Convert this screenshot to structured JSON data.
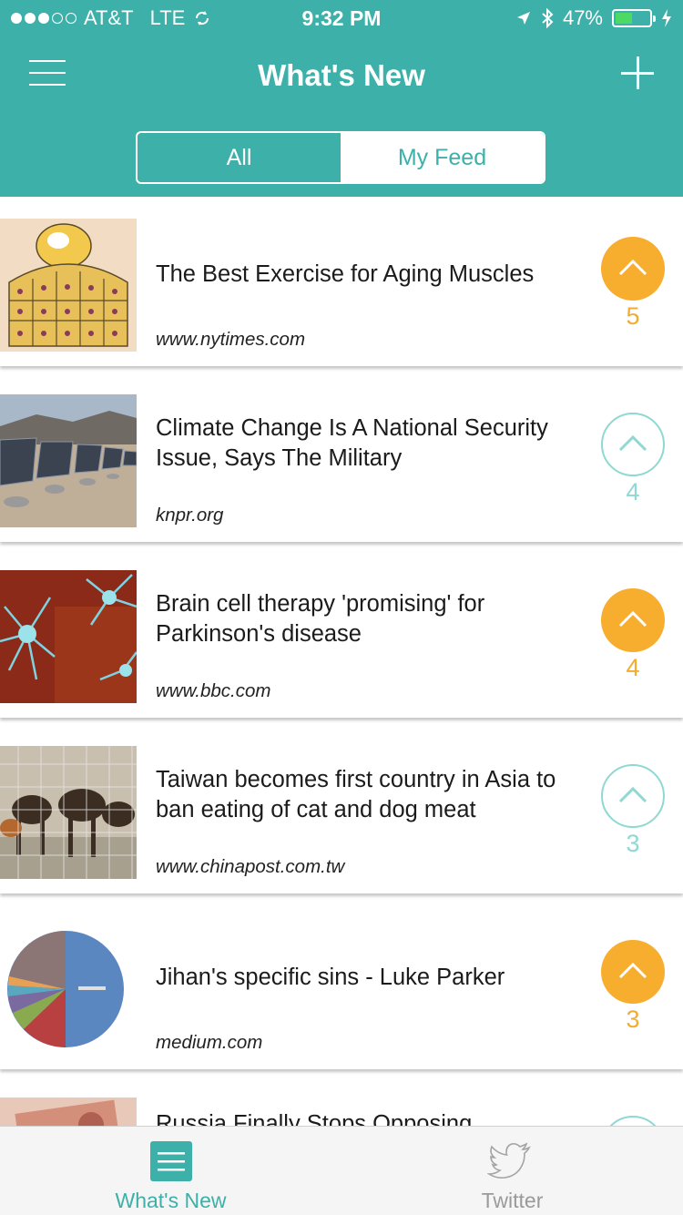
{
  "status_bar": {
    "carrier": "AT&T",
    "network": "LTE",
    "time": "9:32 PM",
    "battery": "47%",
    "battery_level": 0.47
  },
  "header": {
    "title": "What's New",
    "menu_icon": "hamburger-menu-icon",
    "add_icon": "plus-icon",
    "background": "#3cb0a9"
  },
  "segments": {
    "all": "All",
    "my_feed": "My Feed",
    "selected": "All"
  },
  "feed": [
    {
      "title": "The Best Exercise for Aging Muscles",
      "source": "www.nytimes.com",
      "votes": "5",
      "upvoted": true,
      "thumb": "cartoon-illustration"
    },
    {
      "title": "Climate Change Is A National Security Issue, Says The Military",
      "source": "knpr.org",
      "votes": "4",
      "upvoted": false,
      "thumb": "solar-panels-photo"
    },
    {
      "title": "Brain cell therapy 'promising' for Parkinson's disease",
      "source": "www.bbc.com",
      "votes": "4",
      "upvoted": true,
      "thumb": "neuron-illustration"
    },
    {
      "title": "Taiwan becomes first country in Asia to ban eating of cat and dog meat",
      "source": "www.chinapost.com.tw",
      "votes": "3",
      "upvoted": false,
      "thumb": "dogs-in-cage-photo"
    },
    {
      "title": "Jihan's specific sins - Luke Parker",
      "source": "medium.com",
      "votes": "3",
      "upvoted": true,
      "thumb": "pie-chart-image"
    },
    {
      "title": "Russia Finally Stops Opposing",
      "source": "",
      "votes": "",
      "upvoted": false,
      "thumb": "banknotes-photo"
    }
  ],
  "colors": {
    "accent": "#3cb0a9",
    "upvote_active": "#f7ae2e",
    "upvote_inactive": "#8fd8d3"
  },
  "tabbar": {
    "whats_new": "What's New",
    "twitter": "Twitter",
    "whats_new_icon": "list-icon",
    "twitter_icon": "twitter-bird-icon"
  }
}
